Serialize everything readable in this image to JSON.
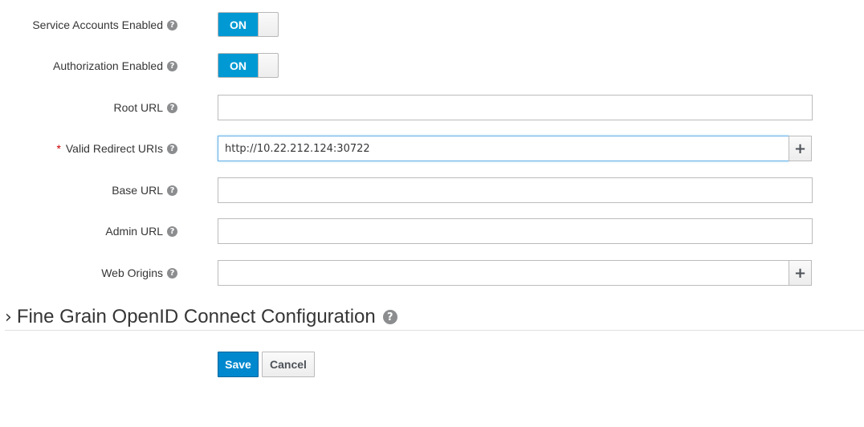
{
  "fields": {
    "service_accounts": {
      "label": "Service Accounts Enabled",
      "toggle": "ON"
    },
    "authorization": {
      "label": "Authorization Enabled",
      "toggle": "ON"
    },
    "root_url": {
      "label": "Root URL",
      "value": ""
    },
    "valid_redirect_uris": {
      "required_mark": "*",
      "label": "Valid Redirect URIs",
      "value": "http://10.22.212.124:30722"
    },
    "base_url": {
      "label": "Base URL",
      "value": ""
    },
    "admin_url": {
      "label": "Admin URL",
      "value": ""
    },
    "web_origins": {
      "label": "Web Origins",
      "value": ""
    }
  },
  "help_glyph": "?",
  "add_glyph": "+",
  "section": {
    "chevron": "›",
    "title": "Fine Grain OpenID Connect Configuration"
  },
  "buttons": {
    "save": "Save",
    "cancel": "Cancel"
  },
  "colors": {
    "toggle_on": "#0099d3",
    "primary_button": "#0088ce",
    "required": "#cc0000"
  }
}
